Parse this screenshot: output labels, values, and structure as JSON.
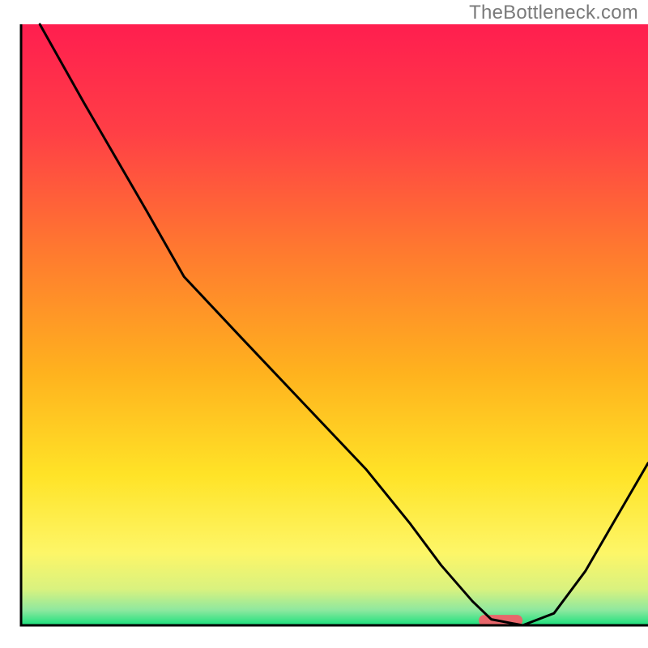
{
  "watermark": "TheBottleneck.com",
  "chart_data": {
    "type": "line",
    "title": "",
    "xlabel": "",
    "ylabel": "",
    "xlim": [
      0,
      100
    ],
    "ylim": [
      0,
      100
    ],
    "x": [
      3,
      10,
      20,
      26,
      35,
      45,
      55,
      62,
      67,
      72,
      75,
      80,
      85,
      90,
      95,
      100
    ],
    "values": [
      100,
      87,
      69,
      58,
      48,
      37,
      26,
      17,
      10,
      4,
      1,
      0,
      2,
      9,
      18,
      27
    ],
    "marker": {
      "x_start": 73,
      "x_end": 80,
      "y": 0.8
    },
    "gradient_stops": [
      {
        "offset": 0.0,
        "color": "#ff1e4f"
      },
      {
        "offset": 0.18,
        "color": "#ff3f46"
      },
      {
        "offset": 0.38,
        "color": "#ff7a2f"
      },
      {
        "offset": 0.58,
        "color": "#ffb21e"
      },
      {
        "offset": 0.75,
        "color": "#ffe327"
      },
      {
        "offset": 0.88,
        "color": "#fdf668"
      },
      {
        "offset": 0.94,
        "color": "#d9f27f"
      },
      {
        "offset": 0.975,
        "color": "#8de89f"
      },
      {
        "offset": 1.0,
        "color": "#19e07b"
      }
    ],
    "axis_color": "#000000",
    "curve_color": "#000000",
    "marker_color": "#e8676b",
    "background_outside": "#ffffff"
  }
}
